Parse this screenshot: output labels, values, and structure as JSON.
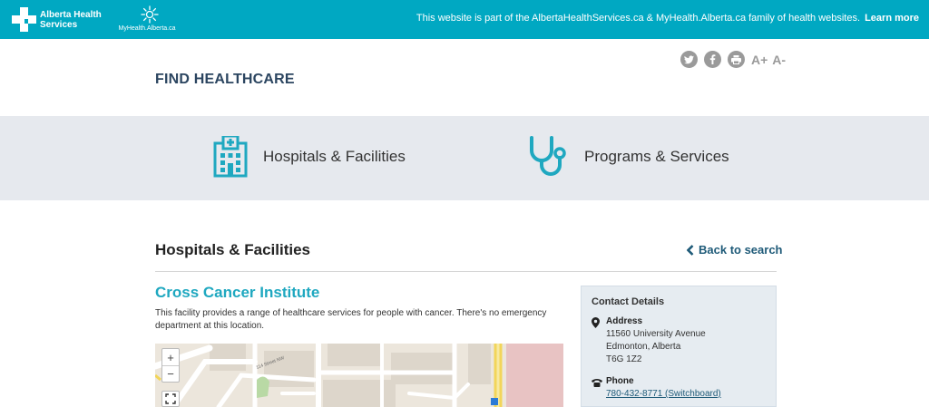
{
  "topbar": {
    "ahs_logo_text": "Alberta Health Services",
    "myhealth_logo_text": "MyHealth.Alberta.ca",
    "message": "This website is part of the AlbertaHealthServices.ca & MyHealth.Alberta.ca family of health websites.",
    "learn_more": "Learn more",
    "background_color": "#00a8c2"
  },
  "share": {
    "icons": [
      "twitter-icon",
      "facebook-icon",
      "print-icon"
    ],
    "text_increase": "A+",
    "text_decrease": "A-"
  },
  "page": {
    "title": "FIND HEALTHCARE"
  },
  "categories": [
    {
      "label": "Hospitals & Facilities",
      "icon": "hospital-building-icon"
    },
    {
      "label": "Programs & Services",
      "icon": "stethoscope-icon"
    }
  ],
  "section": {
    "title": "Hospitals & Facilities",
    "back_label": "Back to search"
  },
  "facility": {
    "name": "Cross Cancer Institute",
    "description": "This facility provides a range of healthcare services for people with cancer. There's no emergency department at this location."
  },
  "map": {
    "zoom_in": "+",
    "zoom_out": "−",
    "street_label": "114 Street NW"
  },
  "contact": {
    "heading": "Contact Details",
    "address_label": "Address",
    "address_lines": [
      "11560 University Avenue",
      "Edmonton, Alberta",
      "T6G 1Z2"
    ],
    "phone_label": "Phone",
    "phone": "780-432-8771 (Switchboard)"
  },
  "colors": {
    "accent": "#1fa8c0",
    "title": "#2b4560",
    "link": "#1e5a78",
    "band": "#e6e9ee"
  }
}
